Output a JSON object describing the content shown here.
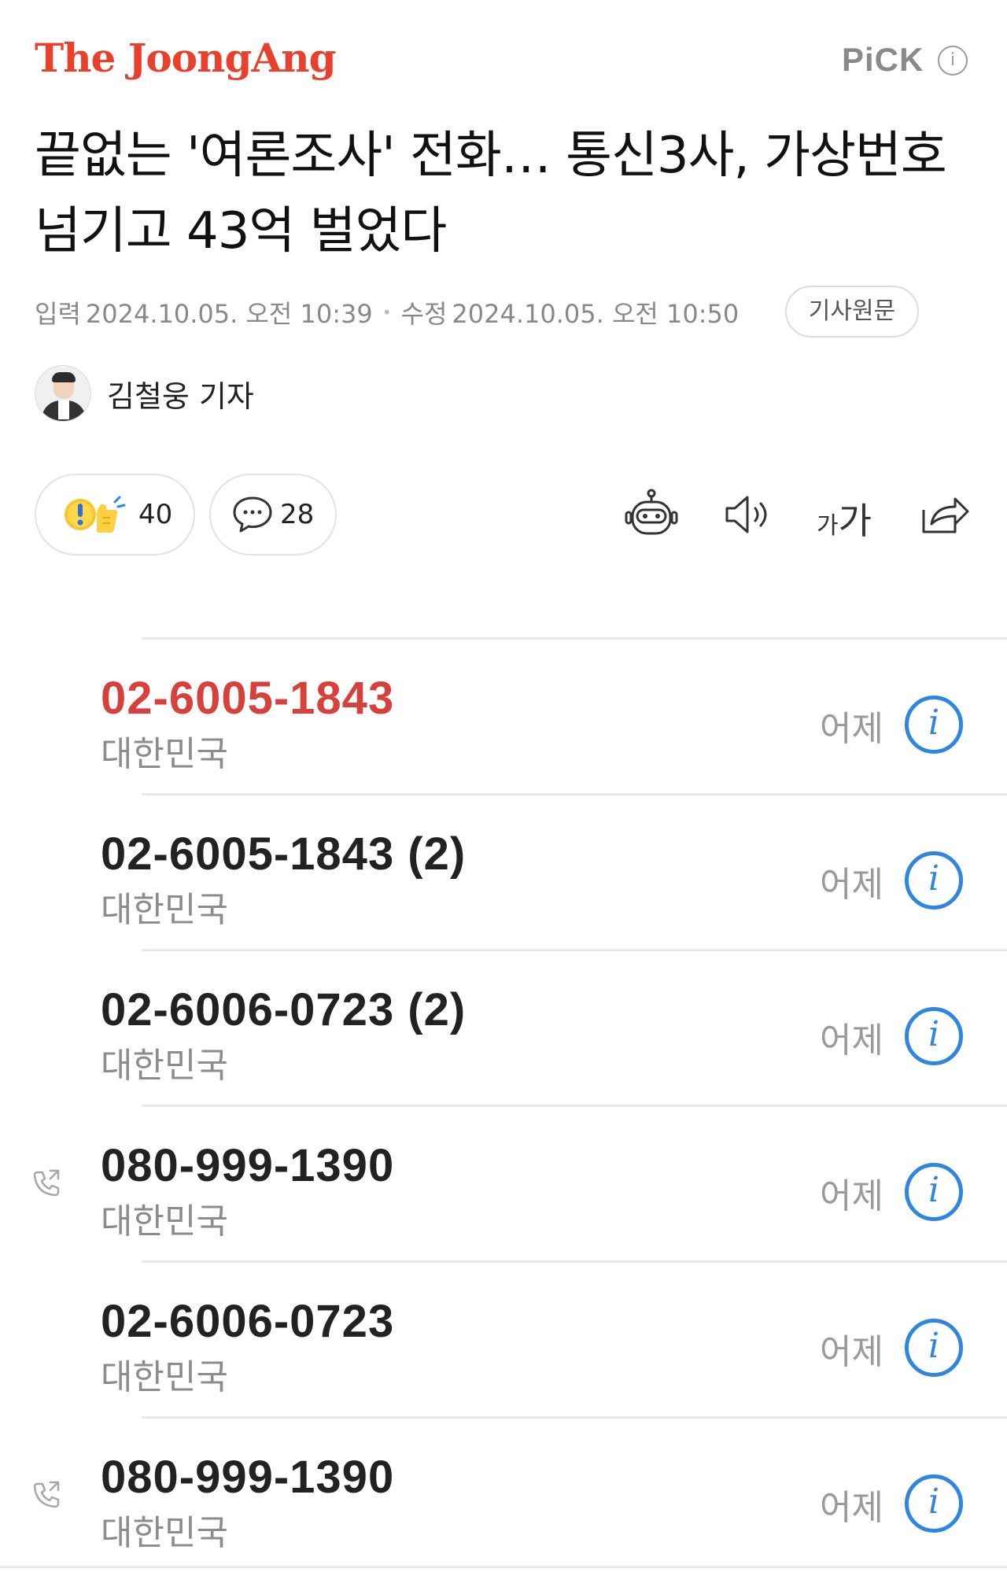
{
  "header": {
    "brand": "The JoongAng",
    "pick_label": "PiCK",
    "pick_info_glyph": "i"
  },
  "article": {
    "headline": "끝없는 '여론조사' 전화… 통신3사, 가상번호 넘기고 43억 벌었다",
    "input_label": "입력",
    "input_datetime": "2024.10.05. 오전 10:39",
    "modified_label": "수정",
    "modified_datetime": "2024.10.05. 오전 10:50",
    "original_button": "기사원문",
    "reporter": "김철웅 기자"
  },
  "actions": {
    "reaction_count": "40",
    "comment_count": "28",
    "fontsize_small": "가",
    "fontsize_large": "가",
    "icons": [
      "reaction-icon",
      "comment-icon",
      "summary-bot-icon",
      "speaker-icon",
      "font-size-icon",
      "share-icon"
    ]
  },
  "call_log": {
    "rows": [
      {
        "number": "02-6005-1843",
        "region": "대한민국",
        "when": "어제",
        "missed": true,
        "call_icon": false
      },
      {
        "number": "02-6005-1843 (2)",
        "region": "대한민국",
        "when": "어제",
        "missed": false,
        "call_icon": false
      },
      {
        "number": "02-6006-0723 (2)",
        "region": "대한민국",
        "when": "어제",
        "missed": false,
        "call_icon": false
      },
      {
        "number": "080-999-1390",
        "region": "대한민국",
        "when": "어제",
        "missed": false,
        "call_icon": true
      },
      {
        "number": "02-6006-0723",
        "region": "대한민국",
        "when": "어제",
        "missed": false,
        "call_icon": false
      },
      {
        "number": "080-999-1390",
        "region": "대한민국",
        "when": "어제",
        "missed": false,
        "call_icon": true
      }
    ],
    "info_glyph": "i"
  },
  "colors": {
    "brand": "#e8402b",
    "missed_call": "#d6423b",
    "info_blue": "#2f86e0"
  }
}
